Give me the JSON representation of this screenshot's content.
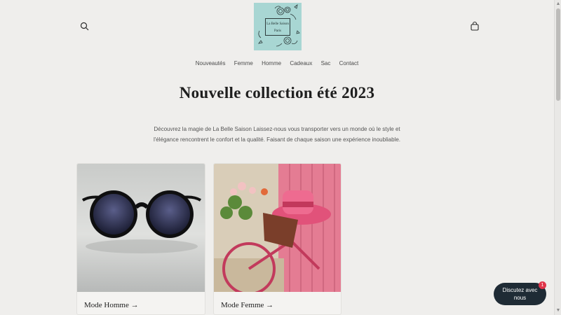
{
  "header": {
    "search_icon": "search-icon",
    "cart_icon": "bag-icon",
    "logo": {
      "line1": "La Belle Saison",
      "line2": "Paris",
      "bg": "#a8d6d3"
    }
  },
  "nav": {
    "items": [
      {
        "label": "Nouveautés"
      },
      {
        "label": "Femme"
      },
      {
        "label": "Homme"
      },
      {
        "label": "Cadeaux"
      },
      {
        "label": "Sac"
      },
      {
        "label": "Contact"
      }
    ]
  },
  "hero": {
    "title": "Nouvelle collection été 2023",
    "description_line1": "Découvrez la magie de La Belle Saison Laissez-nous vous transporter vers un monde où le style et",
    "description_line2": "l'élégance rencontrent le confort et la qualité. Faisant de chaque saison une expérience inoubliable."
  },
  "collections": [
    {
      "label": "Mode Homme →"
    },
    {
      "label": "Mode Femme →"
    }
  ],
  "chat": {
    "label_line1": "Discutez avec",
    "label_line2": "nous",
    "badge": "1",
    "bg": "#1f2b35"
  }
}
